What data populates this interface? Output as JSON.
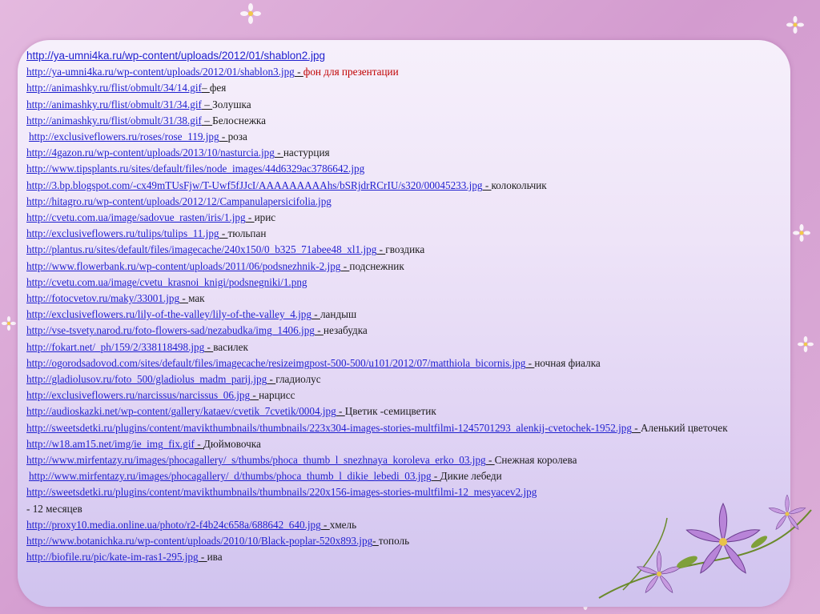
{
  "lines": [
    {
      "url": "http://ya-umni4ka.ru/wp-content/uploads/2012/01/shablon2.jpg",
      "sep": "",
      "text": "",
      "red": false,
      "first": true
    },
    {
      "url": "http://ya-umni4ka.ru/wp-content/uploads/2012/01/shablon3.jpg",
      "sep": " - ",
      "text": "фон для презентации",
      "red": true
    },
    {
      "url": "http://animashky.ru/flist/obmult/34/14.gif",
      "sep": "– ",
      "text": "фея"
    },
    {
      "url": "http://animashky.ru/flist/obmult/31/34.gif",
      "sep": " – ",
      "text": "Золушка"
    },
    {
      "url": "http://animashky.ru/flist/obmult/31/38.gif",
      "sep": " – ",
      "text": "Белоснежка"
    },
    {
      "url": "http://exclusiveflowers.ru/roses/rose_119.jpg",
      "sep": "  - ",
      "text": "роза",
      "indent": true
    },
    {
      "url": "http://4gazon.ru/wp-content/uploads/2013/10/nasturcia.jpg",
      "sep": " - ",
      "text": "настурция"
    },
    {
      "url": "http://www.tipsplants.ru/sites/default/files/node_images/44d6329ac3786642.jpg",
      "sep": "",
      "text": ""
    },
    {
      "url": "http://3.bp.blogspot.com/-cx49mTUsFjw/T-Uwf5fJJcI/AAAAAAAAAhs/bSRjdrRCrIU/s320/00045233.jpg",
      "sep": "  - ",
      "text": "колокольчик"
    },
    {
      "url": "http://hitagro.ru/wp-content/uploads/2012/12/Campanulapersicifolia.jpg",
      "sep": "",
      "text": ""
    },
    {
      "url": "http://cvetu.com.ua/image/sadovue_rasten/iris/1.jpg",
      "sep": " - ",
      "text": "ирис"
    },
    {
      "url": "http://exclusiveflowers.ru/tulips/tulips_11.jpg",
      "sep": " - ",
      "text": "тюльпан"
    },
    {
      "url": "http://plantus.ru/sites/default/files/imagecache/240x150/0_b325_71abee48_xl1.jpg",
      "sep": " - ",
      "text": "гвоздика"
    },
    {
      "url": "http://www.flowerbank.ru/wp-content/uploads/2011/06/podsnezhnik-2.jpg",
      "sep": " -  ",
      "text": "подснежник"
    },
    {
      "url": "http://cvetu.com.ua/image/cvetu_krasnoi_knigi/podsnegniki/1.png",
      "sep": "",
      "text": ""
    },
    {
      "url": "http://fotocvetov.ru/maky/33001.jpg",
      "sep": " - ",
      "text": "мак"
    },
    {
      "url": "http://exclusiveflowers.ru/lily-of-the-valley/lily-of-the-valley_4.jpg",
      "sep": " - ",
      "text": "ландыш"
    },
    {
      "url": "http://vse-tsvety.narod.ru/foto-flowers-sad/nezabudka/img_1406.jpg",
      "sep": " - ",
      "text": "незабудка"
    },
    {
      "url": "http://fokart.net/_ph/159/2/338118498.jpg",
      "sep": " - ",
      "text": "василек"
    },
    {
      "url": "http://ogorodsadovod.com/sites/default/files/imagecache/resizeimgpost-500-500/u101/2012/07/matthiola_bicornis.jpg",
      "sep": " - ",
      "text": "ночная фиалка"
    },
    {
      "url": "http://gladiolusov.ru/foto_500/gladiolus_madm_parij.jpg",
      "sep": " - ",
      "text": "гладиолус"
    },
    {
      "url": "http://exclusiveflowers.ru/narcissus/narcissus_06.jpg",
      "sep": " - ",
      "text": "нарцисс"
    },
    {
      "url": "http://audioskazki.net/wp-content/gallery/kataev/cvetik_7cvetik/0004.jpg",
      "sep": "  - ",
      "text": "Цветик -семицветик"
    },
    {
      "url": "http://sweetsdetki.ru/plugins/content/mavikthumbnails/thumbnails/223x304-images-stories-multfilmi-1245701293_alenkij-cvetochek-1952.jpg",
      "sep": "  - ",
      "text": "Аленький цветочек",
      "wrap": true
    },
    {
      "url": "http://w18.am15.net/img/ie_img_fix.gif",
      "sep": " - ",
      "text": "Дюймовочка"
    },
    {
      "url": "http://www.mirfentazy.ru/images/phocagallery/_s/thumbs/phoca_thumb_l_snezhnaya_koroleva_erko_03.jpg",
      "sep": " - ",
      "text": "Снежная королева"
    },
    {
      "url": "http://www.mirfentazy.ru/images/phocagallery/_d/thumbs/phoca_thumb_l_dikie_lebedi_03.jpg",
      "sep": " - ",
      "text": "Дикие лебеди",
      "indent": true
    },
    {
      "url": "http://sweetsdetki.ru/plugins/content/mavikthumbnails/thumbnails/220x156-images-stories-multfilmi-12_mesyacev2.jpg",
      "sep": "",
      "text": ""
    },
    {
      "url": "",
      "sep": "",
      "text": "- 12 месяцев"
    },
    {
      "url": "http://proxy10.media.online.ua/photo/r2-f4b24c658a/688642_640.jpg",
      "sep": " -  ",
      "text": "хмель"
    },
    {
      "url": "http://www.botanichka.ru/wp-content/uploads/2010/10/Black-poplar-520x893.jpg",
      "sep": "- ",
      "text": "тополь"
    },
    {
      "url": "http://biofile.ru/pic/kate-im-ras1-295.jpg",
      "sep": " - ",
      "text": "ива"
    }
  ]
}
